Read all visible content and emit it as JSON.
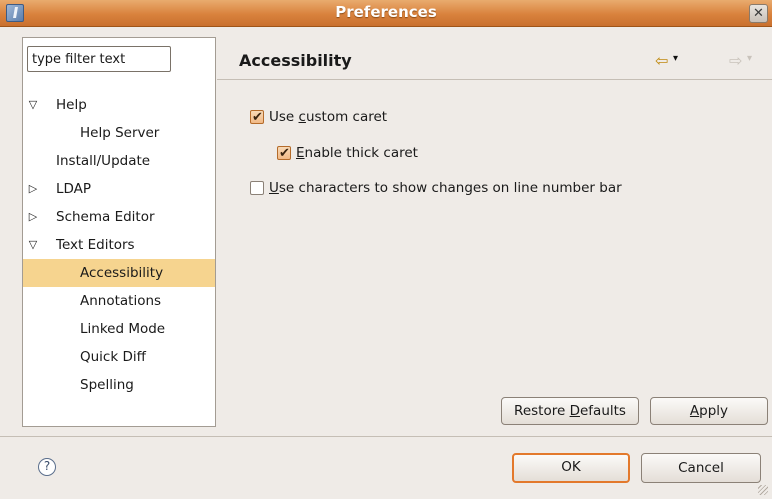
{
  "window": {
    "title": "Preferences",
    "close_glyph": "✕"
  },
  "left": {
    "filter_value": "type filter text",
    "tree": [
      {
        "label": "Help",
        "expander": "▽"
      },
      {
        "label": "Help Server"
      },
      {
        "label": "Install/Update"
      },
      {
        "label": "LDAP",
        "expander": "▷"
      },
      {
        "label": "Schema Editor",
        "expander": "▷"
      },
      {
        "label": "Text Editors",
        "expander": "▽"
      },
      {
        "label": "Accessibility",
        "selected": true
      },
      {
        "label": "Annotations"
      },
      {
        "label": "Linked Mode"
      },
      {
        "label": "Quick Diff"
      },
      {
        "label": "Spelling"
      }
    ]
  },
  "page": {
    "title": "Accessibility",
    "back_icon": "⇦",
    "forward_icon": "⇨",
    "dropdown_glyph": "▾",
    "options": [
      {
        "pre": "Use ",
        "mnemonic": "c",
        "post": "ustom caret",
        "checked": true
      },
      {
        "pre": "",
        "mnemonic": "E",
        "post": "nable thick caret",
        "checked": true
      },
      {
        "pre": "",
        "mnemonic": "U",
        "post": "se characters to show changes on line number bar",
        "checked": false
      }
    ],
    "restore_defaults": {
      "pre": "Restore ",
      "mnemonic": "D",
      "post": "efaults"
    },
    "apply": {
      "pre": "",
      "mnemonic": "A",
      "post": "pply"
    }
  },
  "footer": {
    "help_glyph": "?",
    "ok_label": "OK",
    "cancel_label": "Cancel"
  },
  "colors": {
    "titlebar": "#d9823d",
    "selection": "#f6d48f",
    "default_button_border": "#e3792c"
  }
}
